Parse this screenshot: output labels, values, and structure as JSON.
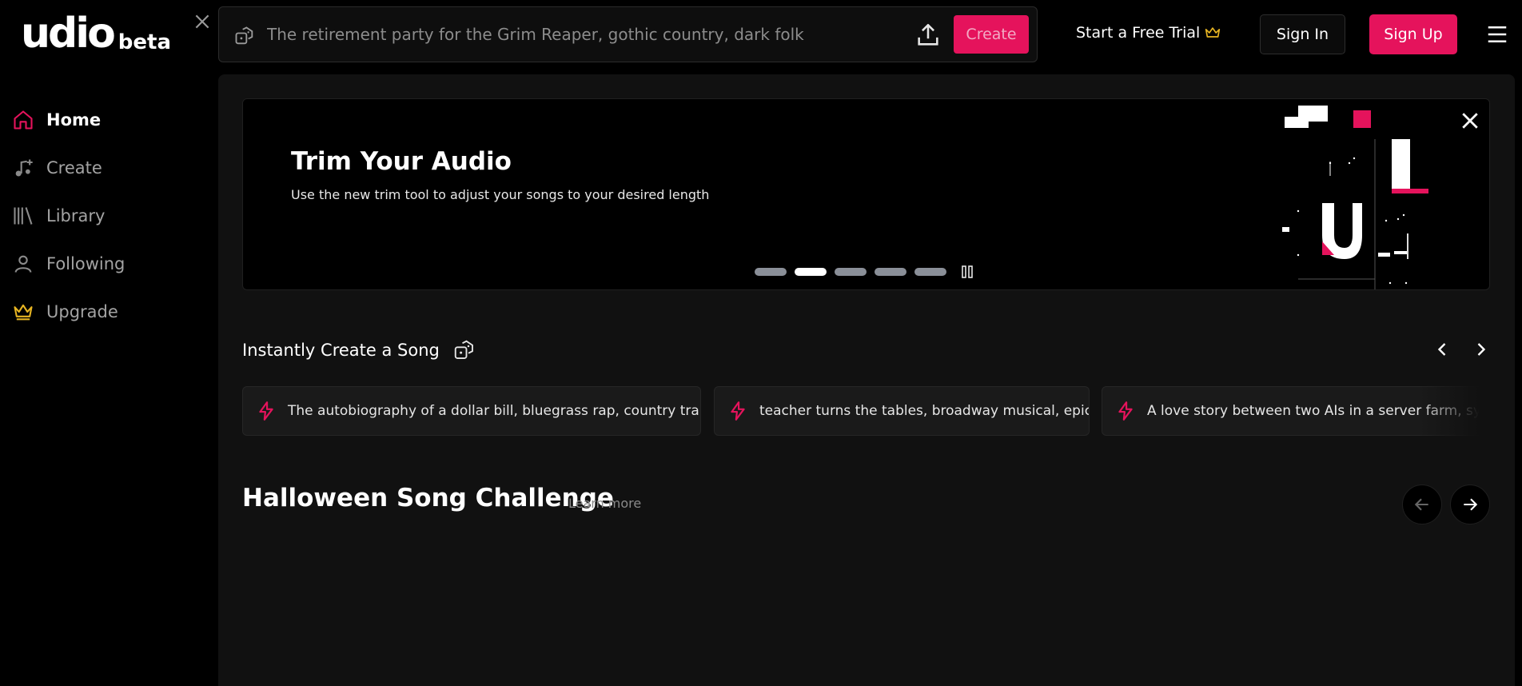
{
  "brand": {
    "name": "udio",
    "tag": "beta"
  },
  "sidebar": {
    "items": [
      {
        "label": "Home",
        "icon": "home-icon",
        "active": true
      },
      {
        "label": "Create",
        "icon": "music-plus-icon",
        "active": false
      },
      {
        "label": "Library",
        "icon": "library-icon",
        "active": false
      },
      {
        "label": "Following",
        "icon": "user-icon",
        "active": false
      },
      {
        "label": "Upgrade",
        "icon": "crown-icon",
        "active": false
      }
    ]
  },
  "topbar": {
    "prompt_placeholder": "The retirement party for the Grim Reaper, gothic country, dark folk",
    "prompt_value": "",
    "create_label": "Create",
    "trial_label": "Start a Free Trial",
    "signin_label": "Sign In",
    "signup_label": "Sign Up"
  },
  "banner": {
    "title": "Trim Your Audio",
    "subtitle": "Use the new trim tool to adjust your songs to your desired length",
    "slide_count": 5,
    "active_slide": 2
  },
  "instant": {
    "title": "Instantly Create a Song",
    "prompts": [
      "The autobiography of a dollar bill, bluegrass rap, country trap",
      "teacher turns the tables, broadway musical, epic",
      "A love story between two AIs in a server farm, synthwave"
    ]
  },
  "challenge": {
    "title": "Halloween Song Challenge",
    "learn_more": "Learn more"
  },
  "colors": {
    "accent": "#e5135c",
    "gold": "#e6b422",
    "panel": "#111111",
    "background": "#000000"
  }
}
